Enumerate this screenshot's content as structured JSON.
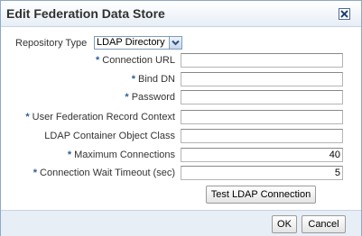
{
  "dialog": {
    "title": "Edit Federation Data Store",
    "close_icon": "close-icon"
  },
  "form": {
    "repository_type": {
      "label": "Repository Type",
      "value": "LDAP Directory"
    },
    "connection_url": {
      "label": "Connection URL",
      "required": true,
      "value": ""
    },
    "bind_dn": {
      "label": "Bind DN",
      "required": true,
      "value": ""
    },
    "password": {
      "label": "Password",
      "required": true,
      "value": ""
    },
    "user_federation_record_context": {
      "label": "User Federation Record Context",
      "required": true,
      "value": ""
    },
    "ldap_container_object_class": {
      "label": "LDAP Container Object Class",
      "required": false,
      "value": ""
    },
    "maximum_connections": {
      "label": "Maximum Connections",
      "required": true,
      "value": "40"
    },
    "connection_wait_timeout": {
      "label": "Connection Wait Timeout (sec)",
      "required": true,
      "value": "5"
    },
    "required_marker": "*",
    "test_button": "Test LDAP Connection"
  },
  "footer": {
    "ok_label": "OK",
    "cancel_label": "Cancel"
  },
  "colors": {
    "accent": "#2c5e9e",
    "header_bg": "#e7eef6",
    "border": "#8fa8c3"
  }
}
